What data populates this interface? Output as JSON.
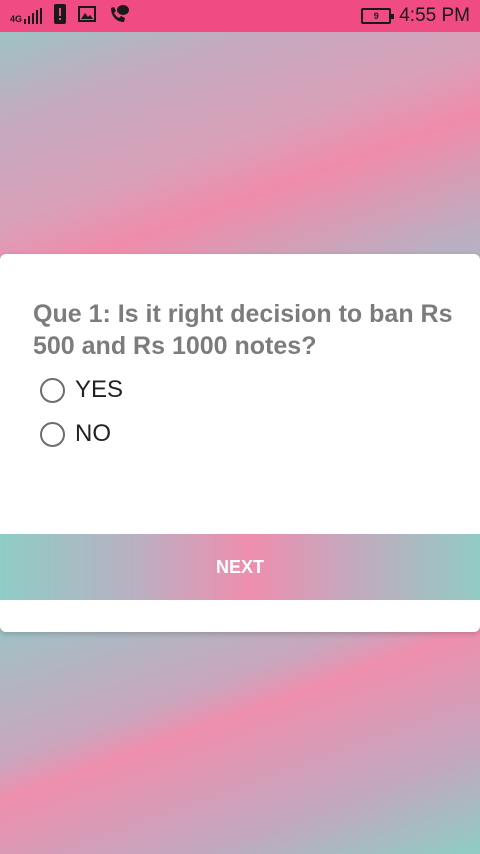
{
  "status_bar": {
    "network_type": "4G",
    "battery_level": "9",
    "time": "4:55 PM"
  },
  "quiz": {
    "question": "Que 1: Is it right decision to ban Rs 500 and Rs 1000 notes?",
    "options": [
      {
        "label": "YES",
        "selected": false
      },
      {
        "label": "NO",
        "selected": false
      }
    ],
    "next_label": "NEXT"
  },
  "colors": {
    "status_bar": "#f04b83",
    "question_text": "#7c7c7c",
    "teal": "#8fcdc6",
    "pink": "#ef8eae"
  }
}
